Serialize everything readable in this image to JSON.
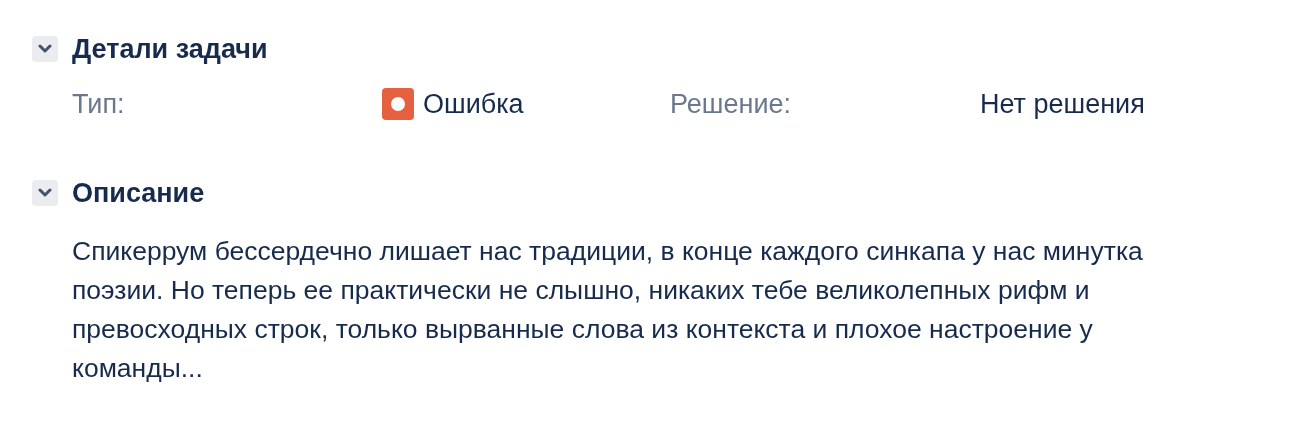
{
  "sections": [
    {
      "kind": "fields",
      "title": "Детали задачи",
      "expanded": true,
      "fields": [
        {
          "label": "Тип:",
          "value": "Ошибка",
          "kind": "with-icon"
        },
        {
          "label": "Решение:",
          "value": "Нет решения",
          "kind": "plain"
        }
      ]
    },
    {
      "kind": "text",
      "title": "Описание",
      "expanded": true,
      "text": "Спикеррум бессердечно лишает нас традиции, в конце каждого синкапа у нас минутка поэзии. Но теперь ее практически не слышно, никаких тебе великолепных рифм и превосходных строк, только вырванные слова из контекста и плохое настроение у команды..."
    }
  ]
}
